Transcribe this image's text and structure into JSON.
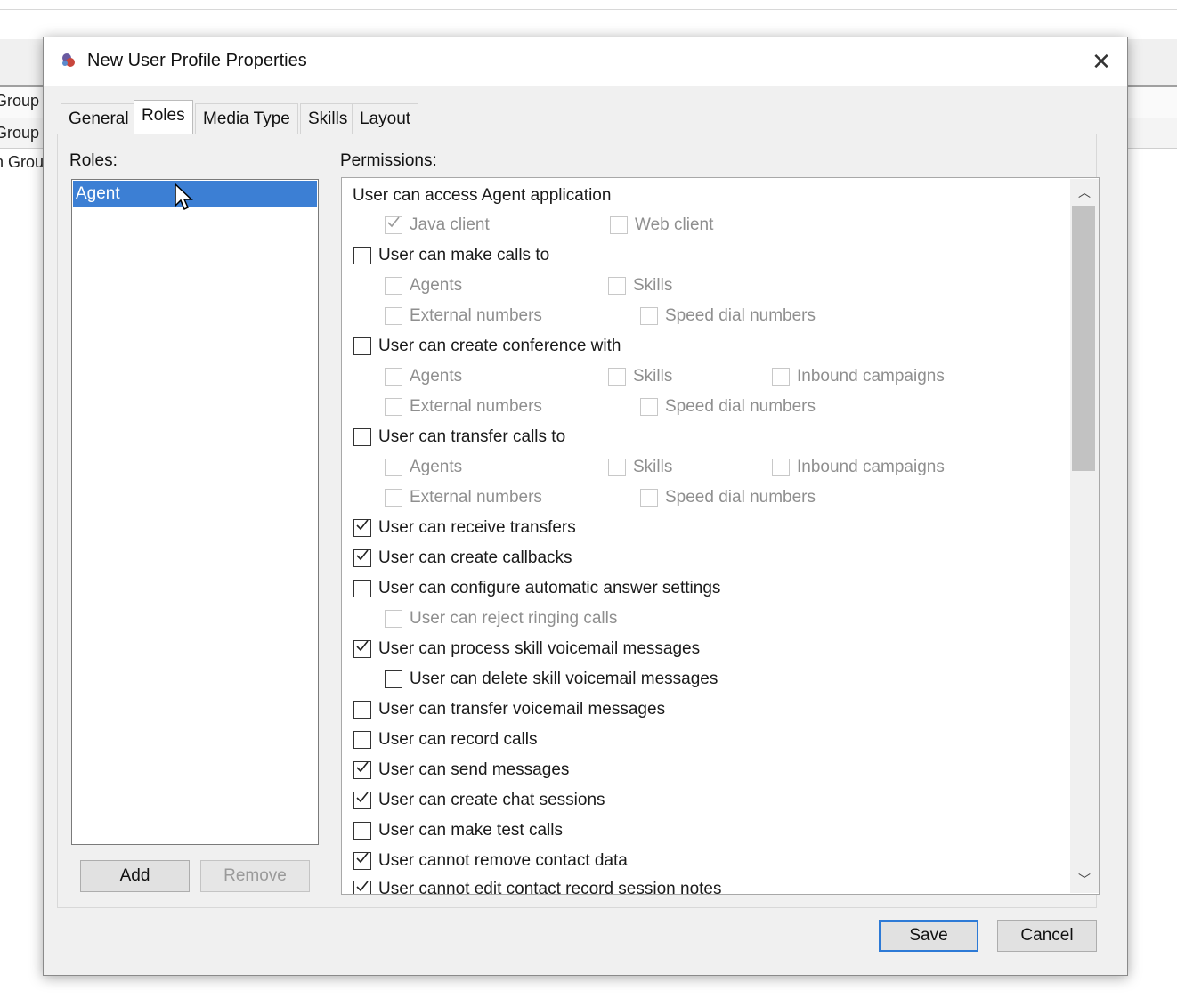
{
  "background": {
    "rows": [
      "Group",
      "Group",
      "n Grou"
    ]
  },
  "dialog": {
    "title": "New User Profile Properties",
    "tabs": [
      {
        "label": "General",
        "active": false
      },
      {
        "label": "Roles",
        "active": true
      },
      {
        "label": "Media Type",
        "active": false
      },
      {
        "label": "Skills",
        "active": false
      },
      {
        "label": "Layout",
        "active": false
      }
    ],
    "roles_label": "Roles:",
    "roles": [
      "Agent"
    ],
    "selected_role": "Agent",
    "add_button": "Add",
    "remove_button": "Remove",
    "permissions_label": "Permissions:",
    "permissions": {
      "access_header": "User can access Agent application",
      "java_client": "Java client",
      "web_client": "Web client",
      "make_calls": "User can make calls to",
      "make_calls_agents": "Agents",
      "make_calls_skills": "Skills",
      "make_calls_external": "External numbers",
      "make_calls_speed": "Speed dial numbers",
      "conference": "User can create conference with",
      "conf_agents": "Agents",
      "conf_skills": "Skills",
      "conf_inbound": "Inbound campaigns",
      "conf_external": "External numbers",
      "conf_speed": "Speed dial numbers",
      "transfer": "User can transfer calls to",
      "trans_agents": "Agents",
      "trans_skills": "Skills",
      "trans_inbound": "Inbound campaigns",
      "trans_external": "External numbers",
      "trans_speed": "Speed dial numbers",
      "receive_transfers": "User can receive transfers",
      "create_callbacks": "User can create callbacks",
      "auto_answer": "User can configure automatic answer settings",
      "reject_ringing": "User can reject ringing calls",
      "process_voicemail": "User can process skill voicemail messages",
      "delete_voicemail": "User can delete skill voicemail messages",
      "transfer_voicemail": "User can transfer voicemail messages",
      "record_calls": "User can record calls",
      "send_messages": "User can send messages",
      "chat_sessions": "User can create chat sessions",
      "test_calls": "User can make test calls",
      "cannot_remove_contact": "User cannot remove contact data",
      "cannot_edit_notes": "User cannot edit contact record session notes"
    },
    "save_button": "Save",
    "cancel_button": "Cancel"
  },
  "colors": {
    "selection": "#3c7fd4",
    "default_button_border": "#2d7ad6",
    "disabled_text": "#8f8f8f"
  }
}
